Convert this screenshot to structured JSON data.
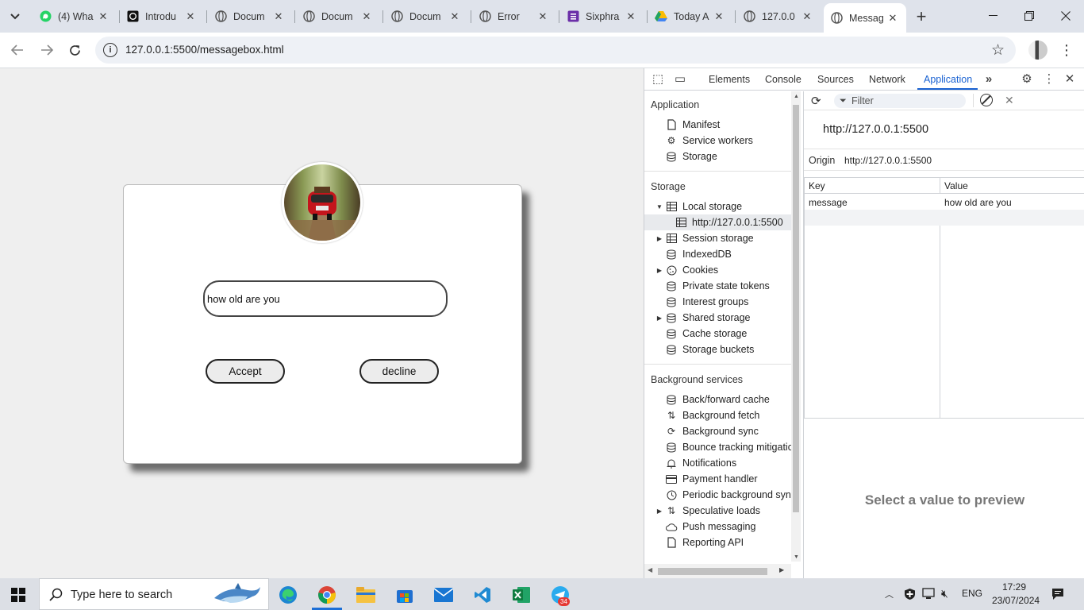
{
  "browser": {
    "tabs": [
      {
        "label": "(4) Wha",
        "icon": "whatsapp-icon"
      },
      {
        "label": "Introdu",
        "icon": "openai-icon"
      },
      {
        "label": "Docum",
        "icon": "globe-icon"
      },
      {
        "label": "Docum",
        "icon": "globe-icon"
      },
      {
        "label": "Docum",
        "icon": "globe-icon"
      },
      {
        "label": "Error",
        "icon": "globe-icon"
      },
      {
        "label": "Sixphra",
        "icon": "sixphrase-icon"
      },
      {
        "label": "Today A",
        "icon": "google-drive-icon"
      },
      {
        "label": "127.0.0",
        "icon": "globe-icon"
      },
      {
        "label": "Messag",
        "icon": "globe-icon",
        "active": true
      }
    ],
    "url": "127.0.0.1:5500/messagebox.html"
  },
  "page": {
    "message_value": "how old are you",
    "accept_label": "Accept",
    "decline_label": "decline"
  },
  "devtools": {
    "tabs": [
      "Elements",
      "Console",
      "Sources",
      "Network",
      "Application"
    ],
    "active_tab": "Application",
    "sidebar": {
      "application_header": "Application",
      "application_items": [
        "Manifest",
        "Service workers",
        "Storage"
      ],
      "storage_header": "Storage",
      "local_storage": "Local storage",
      "local_storage_origin": "http://127.0.0.1:5500",
      "storage_items": [
        "Session storage",
        "IndexedDB",
        "Cookies",
        "Private state tokens",
        "Interest groups",
        "Shared storage",
        "Cache storage",
        "Storage buckets"
      ],
      "background_header": "Background services",
      "background_items": [
        "Back/forward cache",
        "Background fetch",
        "Background sync",
        "Bounce tracking mitigatic",
        "Notifications",
        "Payment handler",
        "Periodic background sync",
        "Speculative loads",
        "Push messaging",
        "Reporting API"
      ]
    },
    "main": {
      "filter_placeholder": "Filter",
      "origin_title": "http://127.0.0.1:5500",
      "origin_label": "Origin",
      "origin_value": "http://127.0.0.1:5500",
      "col_key": "Key",
      "col_value": "Value",
      "rows": [
        {
          "key": "message",
          "value": "how old are you"
        }
      ],
      "preview_text": "Select a value to preview"
    }
  },
  "taskbar": {
    "search_placeholder": "Type here to search",
    "language": "ENG",
    "time": "17:29",
    "date": "23/07/2024",
    "telegram_badge": "34"
  },
  "colors": {
    "devtools_accent": "#1a62d2",
    "tab_strip": "#dfe3eb",
    "page_bg": "#efefef"
  }
}
